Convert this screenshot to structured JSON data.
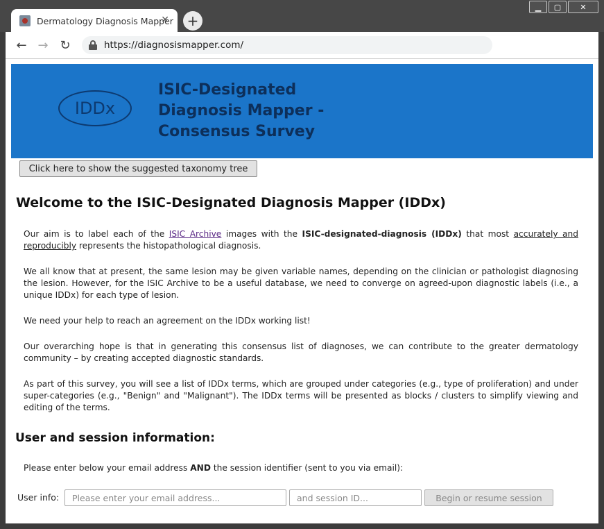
{
  "browser": {
    "tab_title": "Dermatology Diagnosis Mapper",
    "tab_close": "✕",
    "new_tab": "+",
    "url": "https://diagnosismapper.com/",
    "back": "←",
    "forward": "→",
    "reload": "↻",
    "window_controls": {
      "minimize": "▁",
      "maximize": "▢",
      "close": "✕"
    }
  },
  "banner": {
    "logo_text": "IDDx",
    "title_lines": [
      "ISIC-Designated",
      "Diagnosis Mapper -",
      "Consensus Survey"
    ],
    "background": "#1b75c9"
  },
  "taxonomy_button": "Click here to show the suggested taxonomy tree",
  "welcome_heading": "Welcome to the ISIC-Designated Diagnosis Mapper (IDDx)",
  "para1": {
    "t1": "Our aim is to label each of the ",
    "link": "ISIC Archive",
    "t2": " images with the ",
    "bold": "ISIC-designated-diagnosis (IDDx)",
    "t3": " that most ",
    "underlined": "accurately and reproducibly",
    "t4": " represents the histopathological diagnosis."
  },
  "para2": "We all know that at present, the same lesion may be given variable names, depending on the clinician or pathologist diagnosing the lesion. However, for the ISIC Archive to be a useful database, we need to converge on agreed-upon diagnostic labels (i.e., a unique IDDx) for each type of lesion.",
  "para3": "We need your help to reach an agreement on the IDDx working list!",
  "para4": "Our overarching hope is that in generating this consensus list of diagnoses, we can contribute to the greater dermatology community – by creating accepted diagnostic standards.",
  "para5": "As part of this survey, you will see a list of IDDx terms, which are grouped under categories (e.g., type of proliferation) and under super-categories (e.g., \"Benign\" and \"Malignant\"). The IDDx terms will be presented as blocks / clusters to simplify viewing and editing of the terms.",
  "session_heading": "User and session information:",
  "session_intro": {
    "t1": "Please enter below your email address ",
    "bold": "AND",
    "t2": " the session identifier (sent to you via email):"
  },
  "user_info": {
    "label": "User info:",
    "email_placeholder": "Please enter your email address...",
    "session_placeholder": "and session ID...",
    "begin_button": "Begin or resume session"
  }
}
